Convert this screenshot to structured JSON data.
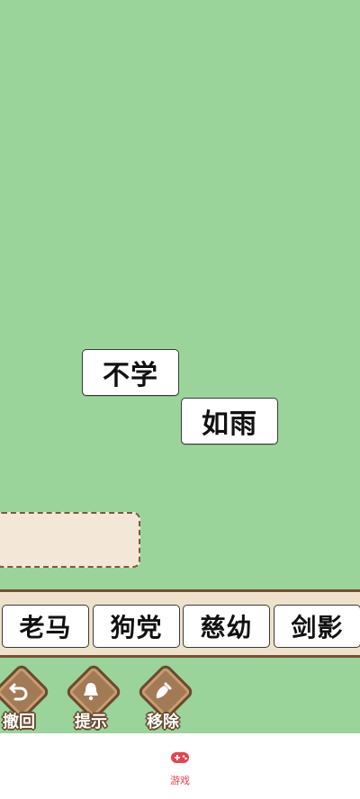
{
  "board_tiles": [
    "不学",
    "如雨"
  ],
  "options": [
    "老马",
    "狗党",
    "慈幼",
    "剑影"
  ],
  "tools": {
    "undo": {
      "label": "撤回",
      "icon": "undo-arrow-icon"
    },
    "hint": {
      "label": "提示",
      "icon": "bell-icon"
    },
    "remove": {
      "label": "移除",
      "icon": "broom-icon"
    }
  },
  "nav": {
    "games_label": "游戏",
    "icon": "gamepad-icon",
    "accent_color": "#e8414e"
  },
  "colors": {
    "background": "#9ad49b",
    "tray": "#f3e8d7",
    "wood": "#a27a55"
  }
}
